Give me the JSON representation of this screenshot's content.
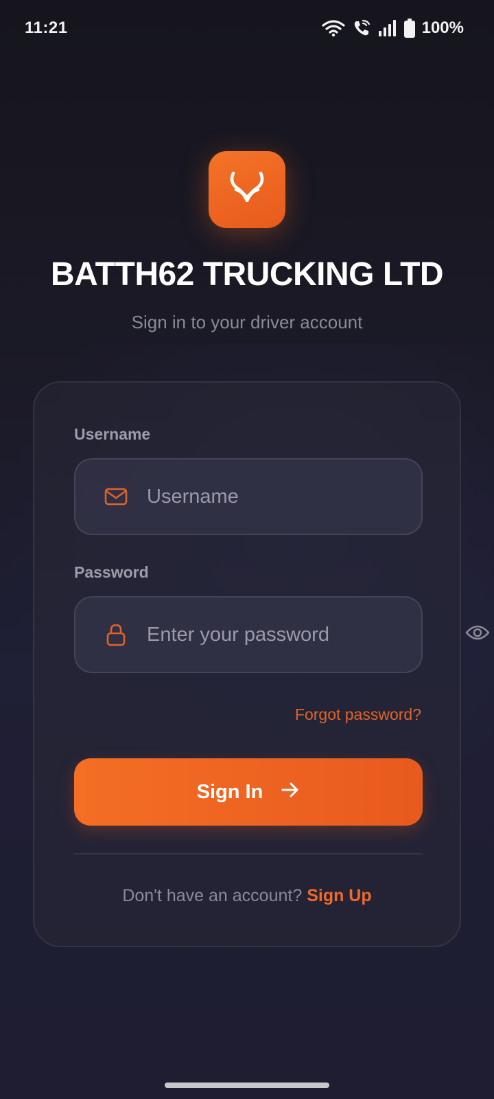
{
  "status_bar": {
    "time": "11:21",
    "battery": "100%",
    "icons": [
      "wifi-icon",
      "wifi-calling-icon",
      "signal-icon",
      "battery-icon"
    ]
  },
  "logo": {
    "icon": "horns-logo-icon"
  },
  "app": {
    "title": "BATTH62 TRUCKING LTD",
    "subtitle": "Sign in to your driver account"
  },
  "form": {
    "username_label": "Username",
    "username_placeholder": "Username",
    "username_value": "",
    "password_label": "Password",
    "password_placeholder": "Enter your password",
    "password_value": "",
    "forgot_password": "Forgot password?",
    "sign_in_label": "Sign In",
    "no_account_text": "Don't have an account?",
    "sign_up_label": "Sign Up"
  },
  "colors": {
    "accent": "#f06a26",
    "background": "#1b1a27",
    "card": "#282837",
    "muted_text": "#8a8a98"
  }
}
